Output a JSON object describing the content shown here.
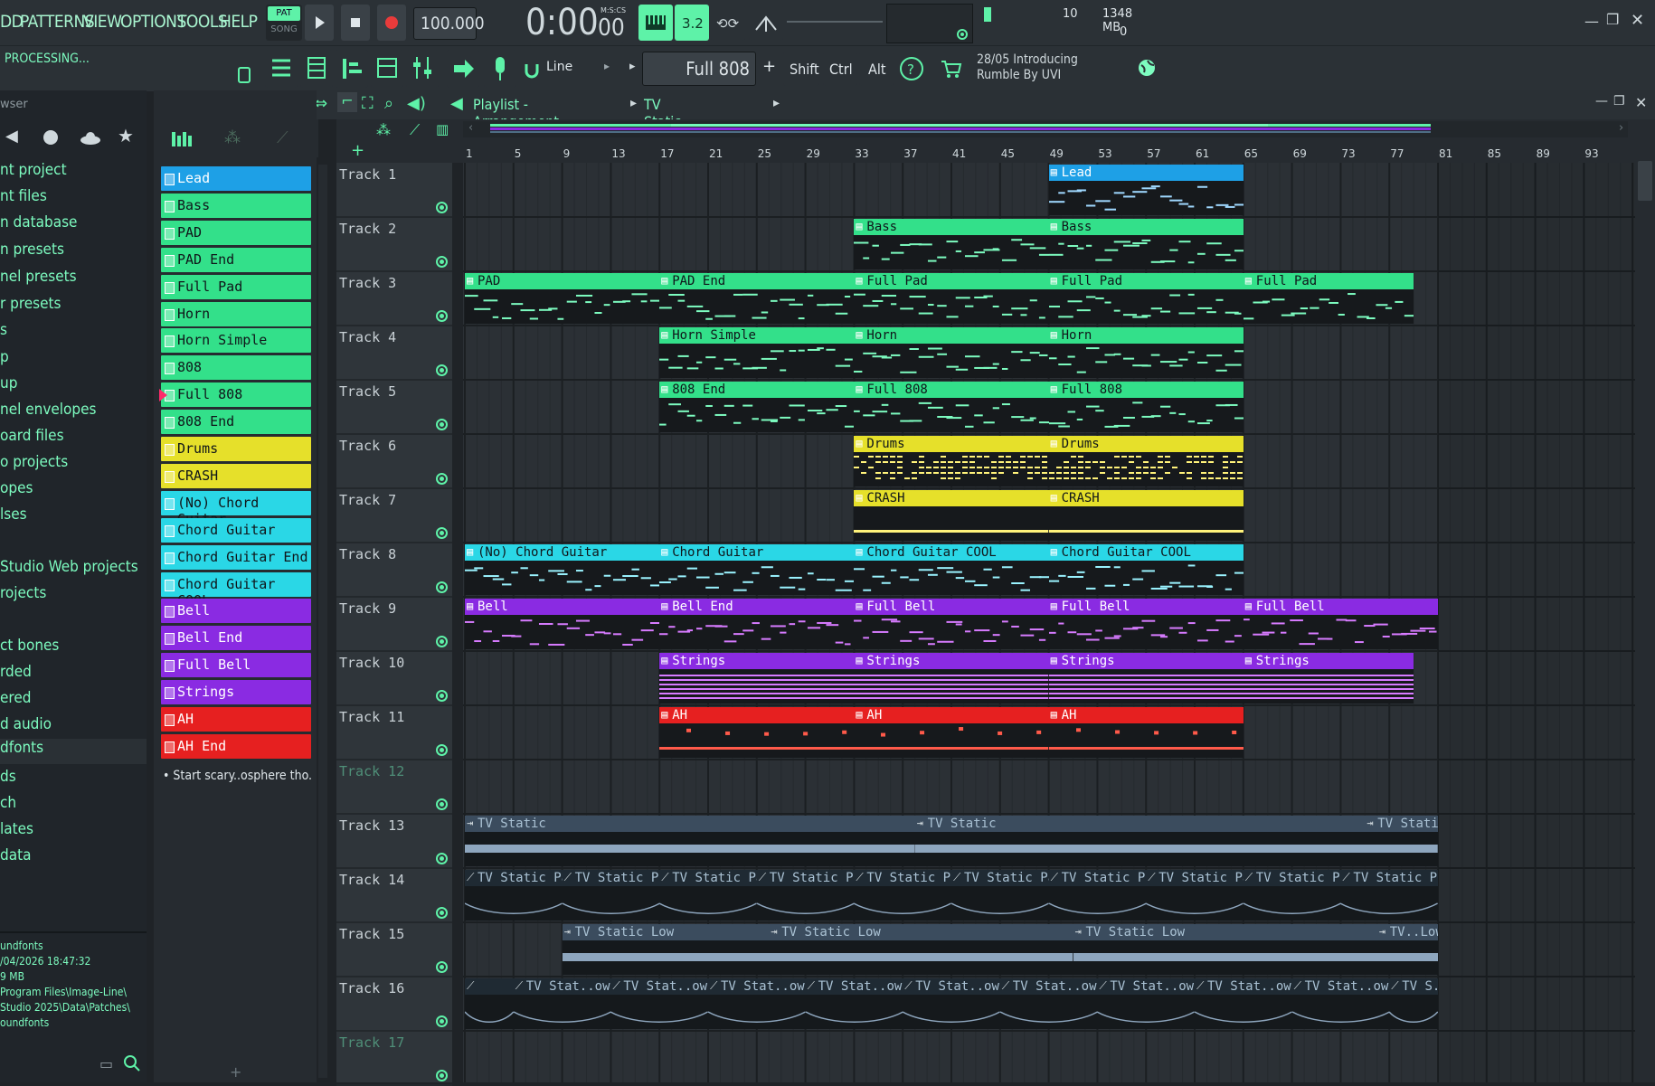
{
  "menu": {
    "items": [
      "DD",
      "PATTERNS",
      "VIEW",
      "OPTIONS",
      "TOOLS",
      "HELP"
    ]
  },
  "transport": {
    "pat_label": "PAT",
    "song_label": "SONG",
    "tempo": "100.000",
    "time": "0:00",
    "time_sub": "00",
    "time_unit": "M:S:CS"
  },
  "status": {
    "processing": "PROCESSING...",
    "cpu": "10",
    "memory": "1348 MB",
    "poly": "0"
  },
  "toolbar": {
    "snap": "Line",
    "pattern": "Full 808",
    "shift": "Shift",
    "ctrl": "Ctrl",
    "alt": "Alt",
    "news_line1": "28/05  Introducing",
    "news_line2": "Rumble By UVI"
  },
  "browser": {
    "title": "wser",
    "items": [
      "nt project",
      "nt files",
      "n database",
      "n presets",
      "nel presets",
      "r presets",
      "s",
      "p",
      "up",
      "nel envelopes",
      "oard files",
      "o projects",
      "opes",
      "lses",
      "",
      "Studio Web projects",
      "rojects",
      "",
      "ct bones",
      "rded",
      "ered",
      "d audio",
      "dfonts",
      "ds",
      "ch",
      "lates",
      "data"
    ],
    "info": [
      "undfonts",
      "/04/2026 18:47:32",
      "9 MB",
      "Program Files\\Image-Line\\",
      "Studio 2025\\Data\\Patches\\",
      "oundfonts"
    ]
  },
  "channels": [
    {
      "name": "Lead",
      "color": "#1ea0e6"
    },
    {
      "name": "Bass",
      "color": "#33e08a"
    },
    {
      "name": "PAD",
      "color": "#33e08a"
    },
    {
      "name": "PAD End",
      "color": "#33e08a"
    },
    {
      "name": "Full Pad",
      "color": "#33e08a"
    },
    {
      "name": "Horn",
      "color": "#33e08a"
    },
    {
      "name": "Horn Simple",
      "color": "#33e08a"
    },
    {
      "name": "808",
      "color": "#33e08a"
    },
    {
      "name": "Full 808",
      "color": "#33e08a"
    },
    {
      "name": "808 End",
      "color": "#33e08a"
    },
    {
      "name": "Drums",
      "color": "#e6e02a"
    },
    {
      "name": "CRASH",
      "color": "#e6e02a"
    },
    {
      "name": "(No) Chord Guitar",
      "color": "#2ad7e6"
    },
    {
      "name": "Chord Guitar",
      "color": "#2ad7e6"
    },
    {
      "name": "Chord Guitar End",
      "color": "#2ad7e6"
    },
    {
      "name": "Chord Guitar COOL",
      "color": "#2ad7e6"
    },
    {
      "name": "Bell",
      "color": "#8a2be2"
    },
    {
      "name": "Bell End",
      "color": "#8a2be2"
    },
    {
      "name": "Full Bell",
      "color": "#8a2be2"
    },
    {
      "name": "Strings",
      "color": "#8a2be2"
    },
    {
      "name": "AH",
      "color": "#e62020"
    },
    {
      "name": "AH End",
      "color": "#e62020"
    }
  ],
  "channel_note": "• Start scary..osphere tho.",
  "playlist": {
    "title": "Playlist - Arrangement",
    "crumb": "TV Static Low Pan",
    "ruler": [
      "1",
      "5",
      "9",
      "13",
      "17",
      "21",
      "25",
      "29",
      "33",
      "37",
      "41",
      "45",
      "49",
      "53",
      "57",
      "61",
      "65",
      "69",
      "73",
      "77",
      "81",
      "85",
      "89",
      "93"
    ],
    "tracks": [
      "Track 1",
      "Track 2",
      "Track 3",
      "Track 4",
      "Track 5",
      "Track 6",
      "Track 7",
      "Track 8",
      "Track 9",
      "Track 10",
      "Track 11",
      "Track 12",
      "Track 13",
      "Track 14",
      "Track 15",
      "Track 16",
      "Track 17"
    ],
    "clips": [
      {
        "track": 0,
        "start": 49,
        "len": 16,
        "name": "Lead",
        "color": "#1ea0e6",
        "kind": "notes"
      },
      {
        "track": 1,
        "start": 33,
        "len": 16,
        "name": "Bass",
        "color": "#33e08a",
        "kind": "notes"
      },
      {
        "track": 1,
        "start": 49,
        "len": 16,
        "name": "Bass",
        "color": "#33e08a",
        "kind": "notes"
      },
      {
        "track": 2,
        "start": 1,
        "len": 16,
        "name": "PAD",
        "color": "#33e08a",
        "kind": "notes"
      },
      {
        "track": 2,
        "start": 17,
        "len": 16,
        "name": "PAD End",
        "color": "#33e08a",
        "kind": "notes"
      },
      {
        "track": 2,
        "start": 33,
        "len": 16,
        "name": "Full Pad",
        "color": "#33e08a",
        "kind": "notes"
      },
      {
        "track": 2,
        "start": 49,
        "len": 16,
        "name": "Full Pad",
        "color": "#33e08a",
        "kind": "notes"
      },
      {
        "track": 2,
        "start": 65,
        "len": 14,
        "name": "Full Pad",
        "color": "#33e08a",
        "kind": "notes"
      },
      {
        "track": 3,
        "start": 17,
        "len": 16,
        "name": "Horn Simple",
        "color": "#33e08a",
        "kind": "notes"
      },
      {
        "track": 3,
        "start": 33,
        "len": 16,
        "name": "Horn",
        "color": "#33e08a",
        "kind": "notes"
      },
      {
        "track": 3,
        "start": 49,
        "len": 16,
        "name": "Horn",
        "color": "#33e08a",
        "kind": "notes"
      },
      {
        "track": 4,
        "start": 17,
        "len": 16,
        "name": "808 End",
        "color": "#33e08a",
        "kind": "notes"
      },
      {
        "track": 4,
        "start": 33,
        "len": 16,
        "name": "Full 808",
        "color": "#33e08a",
        "kind": "notes"
      },
      {
        "track": 4,
        "start": 49,
        "len": 16,
        "name": "Full 808",
        "color": "#33e08a",
        "kind": "notes"
      },
      {
        "track": 5,
        "start": 33,
        "len": 16,
        "name": "Drums",
        "color": "#e6e02a",
        "kind": "drums"
      },
      {
        "track": 5,
        "start": 49,
        "len": 16,
        "name": "Drums",
        "color": "#e6e02a",
        "kind": "drums"
      },
      {
        "track": 6,
        "start": 33,
        "len": 16,
        "name": "CRASH",
        "color": "#e6e02a",
        "kind": "line"
      },
      {
        "track": 6,
        "start": 49,
        "len": 16,
        "name": "CRASH",
        "color": "#e6e02a",
        "kind": "line"
      },
      {
        "track": 7,
        "start": 1,
        "len": 16,
        "name": "(No) Chord Guitar",
        "color": "#2ad7e6",
        "kind": "notes"
      },
      {
        "track": 7,
        "start": 17,
        "len": 16,
        "name": "Chord Guitar",
        "color": "#2ad7e6",
        "kind": "notes"
      },
      {
        "track": 7,
        "start": 33,
        "len": 16,
        "name": "Chord Guitar COOL",
        "color": "#2ad7e6",
        "kind": "notes"
      },
      {
        "track": 7,
        "start": 49,
        "len": 16,
        "name": "Chord Guitar COOL",
        "color": "#2ad7e6",
        "kind": "notes"
      },
      {
        "track": 8,
        "start": 1,
        "len": 16,
        "name": "Bell",
        "color": "#8a2be2",
        "kind": "notes"
      },
      {
        "track": 8,
        "start": 17,
        "len": 16,
        "name": "Bell End",
        "color": "#8a2be2",
        "kind": "notes"
      },
      {
        "track": 8,
        "start": 33,
        "len": 16,
        "name": "Full Bell",
        "color": "#8a2be2",
        "kind": "notes"
      },
      {
        "track": 8,
        "start": 49,
        "len": 16,
        "name": "Full Bell",
        "color": "#8a2be2",
        "kind": "notes"
      },
      {
        "track": 8,
        "start": 65,
        "len": 16,
        "name": "Full Bell",
        "color": "#8a2be2",
        "kind": "notes"
      },
      {
        "track": 9,
        "start": 17,
        "len": 16,
        "name": "Strings",
        "color": "#8a2be2",
        "kind": "strings"
      },
      {
        "track": 9,
        "start": 33,
        "len": 16,
        "name": "Strings",
        "color": "#8a2be2",
        "kind": "strings"
      },
      {
        "track": 9,
        "start": 49,
        "len": 16,
        "name": "Strings",
        "color": "#8a2be2",
        "kind": "strings"
      },
      {
        "track": 9,
        "start": 65,
        "len": 14,
        "name": "Strings",
        "color": "#8a2be2",
        "kind": "strings"
      },
      {
        "track": 10,
        "start": 17,
        "len": 16,
        "name": "AH",
        "color": "#e62020",
        "kind": "ah"
      },
      {
        "track": 10,
        "start": 33,
        "len": 16,
        "name": "AH",
        "color": "#e62020",
        "kind": "ah"
      },
      {
        "track": 10,
        "start": 49,
        "len": 16,
        "name": "AH",
        "color": "#e62020",
        "kind": "ah"
      },
      {
        "track": 12,
        "start": 1,
        "len": 37,
        "name": "TV Static",
        "color": "#3b4c5e",
        "kind": "audio"
      },
      {
        "track": 12,
        "start": 38,
        "len": 37,
        "name": "TV Static",
        "color": "#3b4c5e",
        "kind": "audio"
      },
      {
        "track": 12,
        "start": 75,
        "len": 6,
        "name": "TV Static",
        "color": "#3b4c5e",
        "kind": "audio"
      },
      {
        "track": 13,
        "start": 1,
        "len": 8,
        "name": "TV Static Pan",
        "color": "#1f2a33",
        "kind": "auto"
      },
      {
        "track": 13,
        "start": 9,
        "len": 8,
        "name": "TV Static Pan",
        "color": "#1f2a33",
        "kind": "auto"
      },
      {
        "track": 13,
        "start": 17,
        "len": 8,
        "name": "TV Static Pan",
        "color": "#1f2a33",
        "kind": "auto"
      },
      {
        "track": 13,
        "start": 25,
        "len": 8,
        "name": "TV Static Pan",
        "color": "#1f2a33",
        "kind": "auto"
      },
      {
        "track": 13,
        "start": 33,
        "len": 8,
        "name": "TV Static Pan",
        "color": "#1f2a33",
        "kind": "auto"
      },
      {
        "track": 13,
        "start": 41,
        "len": 8,
        "name": "TV Static Pan",
        "color": "#1f2a33",
        "kind": "auto"
      },
      {
        "track": 13,
        "start": 49,
        "len": 8,
        "name": "TV Static Pan",
        "color": "#1f2a33",
        "kind": "auto"
      },
      {
        "track": 13,
        "start": 57,
        "len": 8,
        "name": "TV Static Pan",
        "color": "#1f2a33",
        "kind": "auto"
      },
      {
        "track": 13,
        "start": 65,
        "len": 8,
        "name": "TV Static Pan",
        "color": "#1f2a33",
        "kind": "auto"
      },
      {
        "track": 13,
        "start": 73,
        "len": 8,
        "name": "TV Static Pan",
        "color": "#1f2a33",
        "kind": "auto"
      },
      {
        "track": 14,
        "start": 9,
        "len": 17,
        "name": "TV Static Low",
        "color": "#3b4c5e",
        "kind": "audio"
      },
      {
        "track": 14,
        "start": 26,
        "len": 25,
        "name": "TV Static Low",
        "color": "#3b4c5e",
        "kind": "audio"
      },
      {
        "track": 14,
        "start": 51,
        "len": 25,
        "name": "TV Static Low",
        "color": "#3b4c5e",
        "kind": "audio"
      },
      {
        "track": 14,
        "start": 76,
        "len": 5,
        "name": "TV..Low",
        "color": "#3b4c5e",
        "kind": "audio"
      },
      {
        "track": 15,
        "start": 1,
        "len": 4,
        "name": "",
        "color": "#1f2a33",
        "kind": "auto"
      },
      {
        "track": 15,
        "start": 5,
        "len": 8,
        "name": "TV Stat..ow Pan",
        "color": "#1f2a33",
        "kind": "auto"
      },
      {
        "track": 15,
        "start": 13,
        "len": 8,
        "name": "TV Stat..ow Pan",
        "color": "#1f2a33",
        "kind": "auto"
      },
      {
        "track": 15,
        "start": 21,
        "len": 8,
        "name": "TV Stat..ow Pan",
        "color": "#1f2a33",
        "kind": "auto"
      },
      {
        "track": 15,
        "start": 29,
        "len": 8,
        "name": "TV Stat..ow Pan",
        "color": "#1f2a33",
        "kind": "auto"
      },
      {
        "track": 15,
        "start": 37,
        "len": 8,
        "name": "TV Stat..ow Pan",
        "color": "#1f2a33",
        "kind": "auto"
      },
      {
        "track": 15,
        "start": 45,
        "len": 8,
        "name": "TV Stat..ow Pan",
        "color": "#1f2a33",
        "kind": "auto"
      },
      {
        "track": 15,
        "start": 53,
        "len": 8,
        "name": "TV Stat..ow Pan",
        "color": "#1f2a33",
        "kind": "auto"
      },
      {
        "track": 15,
        "start": 61,
        "len": 8,
        "name": "TV Stat..ow Pan",
        "color": "#1f2a33",
        "kind": "auto"
      },
      {
        "track": 15,
        "start": 69,
        "len": 8,
        "name": "TV Stat..ow Pan",
        "color": "#1f2a33",
        "kind": "auto"
      },
      {
        "track": 15,
        "start": 77,
        "len": 4,
        "name": "TV S..Pan",
        "color": "#1f2a33",
        "kind": "auto"
      }
    ]
  }
}
